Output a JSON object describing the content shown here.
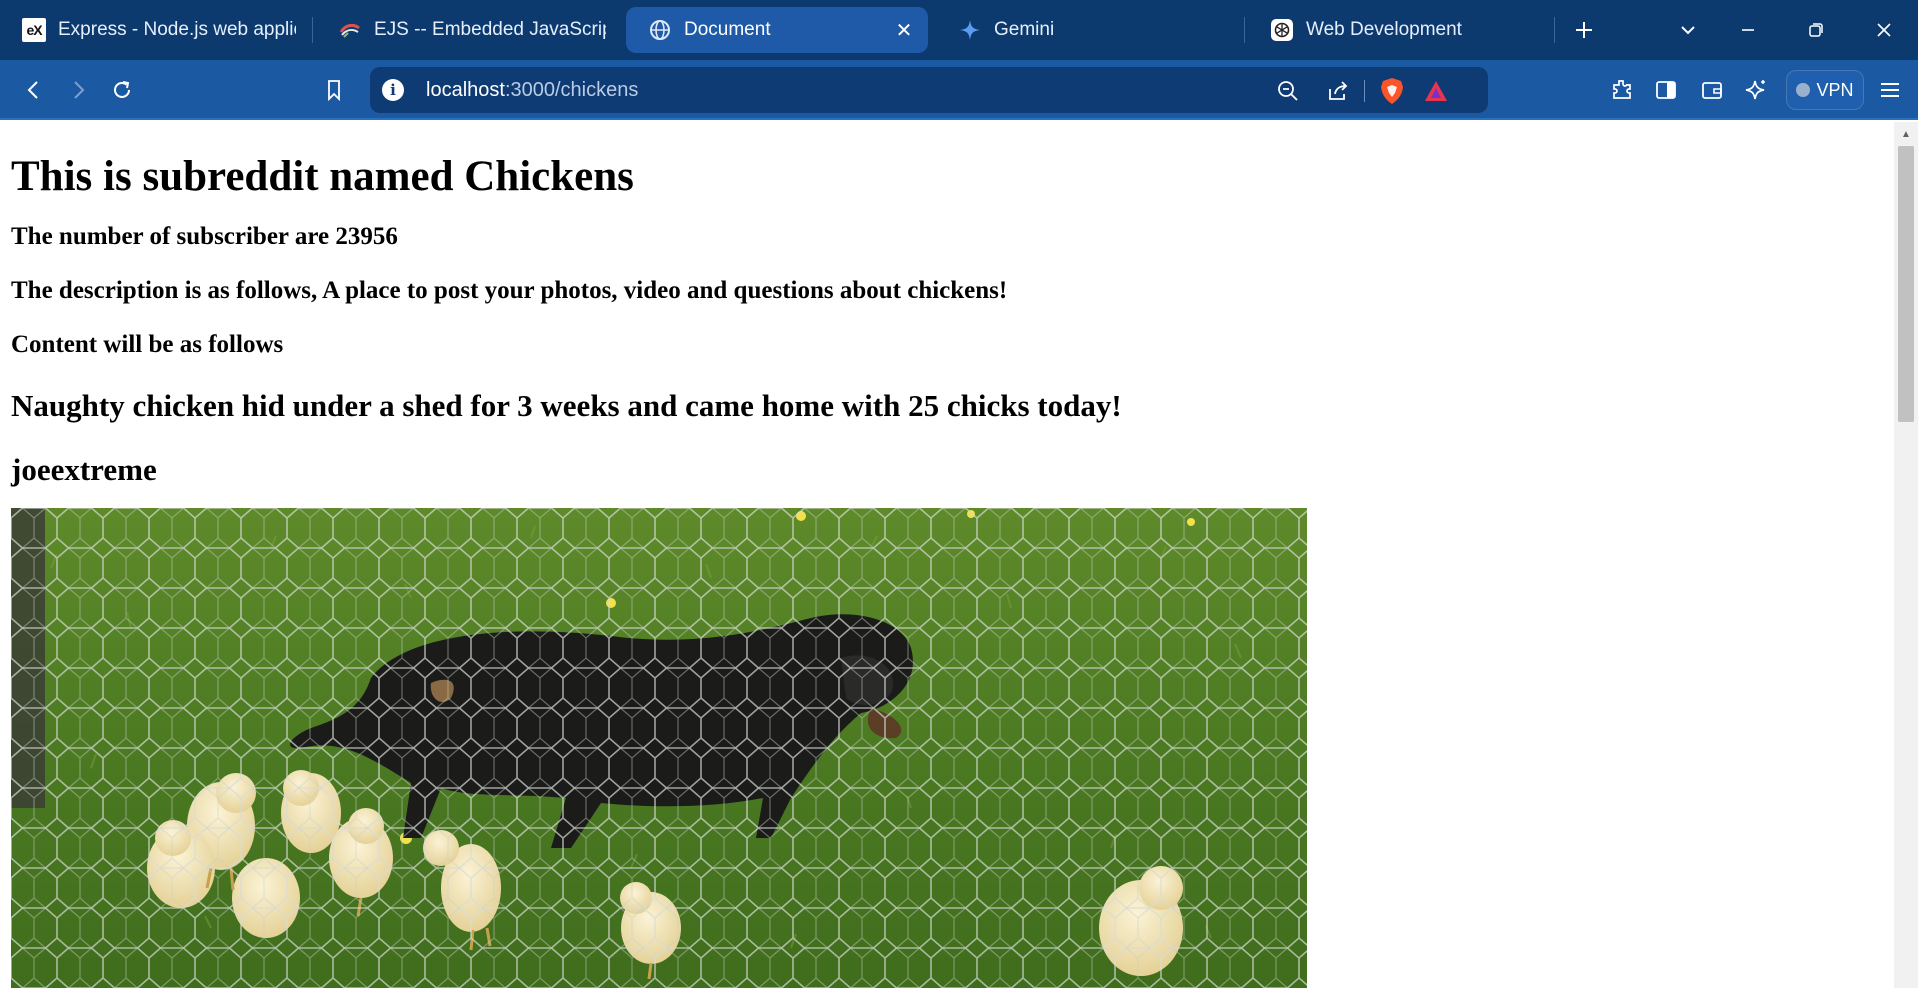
{
  "tabs": [
    {
      "title": "Express - Node.js web applica",
      "favicon": "express-favicon",
      "active": false
    },
    {
      "title": "EJS -- Embedded JavaScript te",
      "favicon": "ejs-favicon",
      "active": false
    },
    {
      "title": "Document",
      "favicon": "globe-icon",
      "active": true
    },
    {
      "title": "Gemini",
      "favicon": "gemini-sparkle-icon",
      "active": false
    },
    {
      "title": "Web Development",
      "favicon": "openai-icon",
      "active": false
    }
  ],
  "toolbar": {
    "url_host": "localhost",
    "url_path": ":3000/chickens",
    "vpn_label": "VPN"
  },
  "page": {
    "heading": "This is subreddit named Chickens",
    "subscribers": "The number of subscriber are 23956",
    "description": "The description is as follows, A place to post your photos, video and questions about chickens!",
    "content_intro": "Content will be as follows",
    "post": {
      "title": "Naughty chicken hid under a shed for 3 weeks and came home with 25 chicks today!",
      "author": "joeextreme",
      "image": "photo of a black dog behind chicken-wire fence with a group of yellow chicks on green grass"
    }
  },
  "colors": {
    "tabstrip_bg": "#0d3a6e",
    "toolbar_bg": "#1b5aa3",
    "urlbar_bg": "#0e3b73",
    "active_tab_bg": "#1e5aa8",
    "brave_orange": "#fb542b"
  }
}
